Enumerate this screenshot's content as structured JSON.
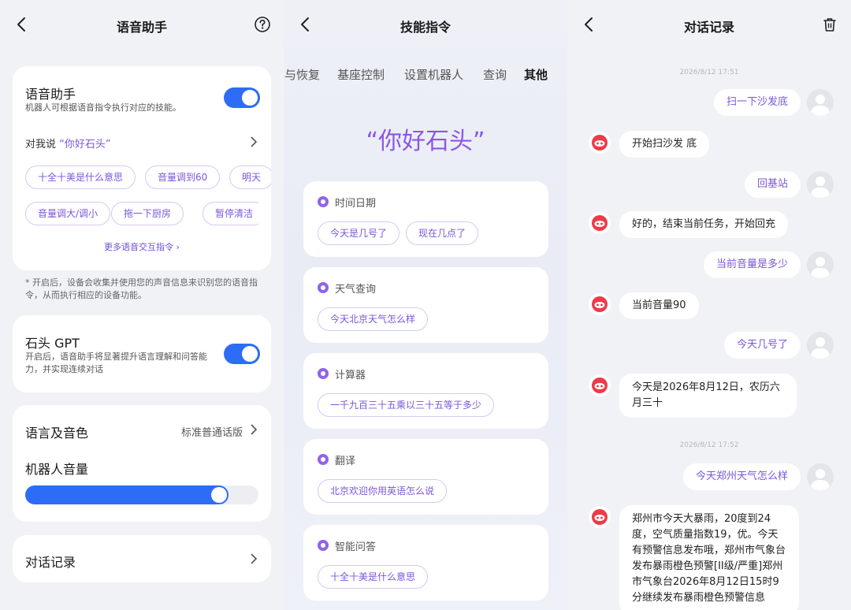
{
  "panel1": {
    "title": "语音助手",
    "voice": {
      "title": "语音助手",
      "desc": "机器人可根据语音指令执行对应的技能。",
      "say_prefix": "对我说",
      "wake_word": "“你好石头”",
      "chips_row1": [
        "十全十美是什么意思",
        "音量调到60",
        "明天"
      ],
      "chips_row2": [
        "音量调大/调小",
        "拖一下厨房",
        "暂停清洁"
      ],
      "more_link": "更多语音交互指令 ›"
    },
    "note": "* 开启后，设备会收集并使用您的声音信息来识别您的语音指令，从而执行相应的设备功能。",
    "gpt": {
      "title": "石头 GPT",
      "desc": "开启后，语音助手将显著提升语言理解和问答能力，并实现连续对话"
    },
    "lang": {
      "label": "语言及音色",
      "value": "标准普通话版"
    },
    "volume": {
      "label": "机器人音量",
      "level": 0.87
    },
    "history": {
      "label": "对话记录"
    }
  },
  "panel2": {
    "title": "技能指令",
    "tabs": [
      "与恢复",
      "基座控制",
      "设置机器人",
      "查询",
      "其他"
    ],
    "active_tab": "其他",
    "hello": "“你好石头”",
    "skills": [
      {
        "name": "时间日期",
        "chips": [
          "今天是几号了",
          "现在几点了"
        ]
      },
      {
        "name": "天气查询",
        "chips": [
          "今天北京天气怎么样"
        ]
      },
      {
        "name": "计算器",
        "chips": [
          "一千九百三十五乘以三十五等于多少"
        ]
      },
      {
        "name": "翻译",
        "chips": [
          "北京欢迎你用英语怎么说"
        ]
      },
      {
        "name": "智能问答",
        "chips": [
          "十全十美是什么意思"
        ]
      }
    ]
  },
  "panel3": {
    "title": "对话记录",
    "ts1": "2026/8/12 17:51",
    "ts2": "2026/8/12 17:52",
    "messages": [
      {
        "from": "user",
        "text": "扫一下沙发底"
      },
      {
        "from": "bot",
        "text": "开始扫沙发 底"
      },
      {
        "from": "user",
        "text": "回基站"
      },
      {
        "from": "bot",
        "text": "好的，结束当前任务，开始回充"
      },
      {
        "from": "user",
        "text": "当前音量是多少"
      },
      {
        "from": "bot",
        "text": "当前音量90"
      },
      {
        "from": "user",
        "text": "今天几号了"
      },
      {
        "from": "bot",
        "text": "今天是2026年8月12日，农历六月三十"
      },
      {
        "from": "user",
        "text": "今天郑州天气怎么样"
      },
      {
        "from": "bot",
        "text": "郑州市今天大暴雨，20度到24度，空气质量指数19，优。今天有预警信息发布哦，郑州市气象台发布暴雨橙色预警[II级/严重]郑州市气象台2026年8月12日15时9分继续发布暴雨橙色预警信息"
      }
    ]
  }
}
